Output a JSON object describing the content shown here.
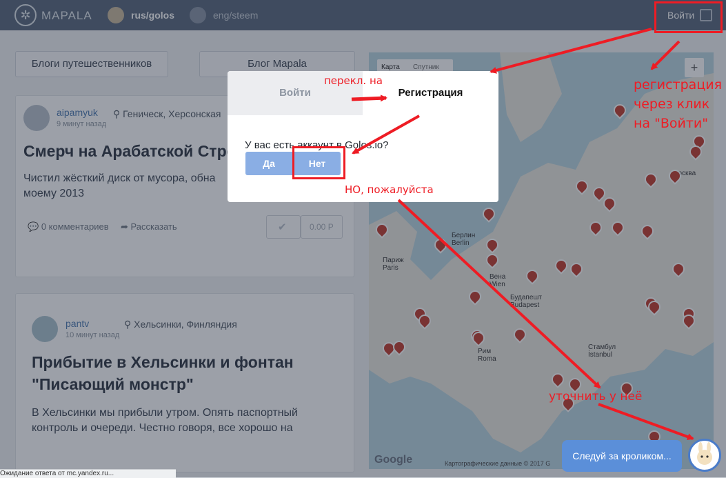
{
  "header": {
    "logo_text": "MAPALA",
    "chains": [
      "rus/golos",
      "eng/steem"
    ],
    "login_label": "Войти"
  },
  "tabs": [
    "Блоги путешественников",
    "Блог Mapala"
  ],
  "posts": [
    {
      "author": "aipamyuk",
      "time": "9 минут назад",
      "location": "Геническ, Херсонская",
      "title": "Смерч на Арабатской Стрел",
      "text": "Чистил жёсткий диск от мусора, обна\nмоему 2013",
      "comments": "0 комментариев",
      "share": "Рассказать",
      "payout": "0.00 Р"
    },
    {
      "author": "pantv",
      "time": "10 минут назад",
      "location": "Хельсинки, Финляндия",
      "title_lines": [
        "Прибытие в Хельсинки и фонтан",
        "\"Писающий монстр\""
      ],
      "text": "В Хельсинки мы прибыли утром. Опять паспортный\nконтроль и очереди. Честно говоря, все хорошо на"
    }
  ],
  "map": {
    "type_tabs": [
      "Карта",
      "Спутник"
    ],
    "zoom_in": "+",
    "cities": [
      "Москва",
      "Берлин\nBerlin",
      "Париж\nParis",
      "Вена\nWien",
      "Будапешт\nBudapest",
      "Рим\nRoma",
      "Стамбул\nİstanbul"
    ],
    "attribution": "Картографические данные © 2017 G",
    "google": "Google"
  },
  "modal": {
    "tab_login": "Войти",
    "tab_register": "Регистрация",
    "question": "У вас есть аккаунт в Golos.io?",
    "yes": "Да",
    "no": "Нет"
  },
  "annotations": {
    "switch": "перекл. на",
    "reg_lines": [
      "регистрация",
      "через клик",
      "на \"Войти\""
    ],
    "but_please": "НО, пожалуйста",
    "clarify": "уточнить у неё"
  },
  "chat": {
    "bubble": "Следуй за кроликом..."
  },
  "status_bar": "Ожидание ответа от mc.yandex.ru..."
}
